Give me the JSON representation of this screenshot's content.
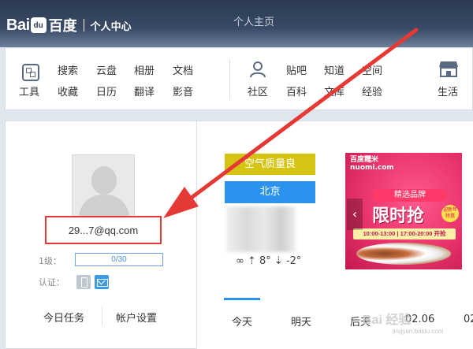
{
  "header": {
    "logo_bai": "Bai",
    "logo_du": "百度",
    "logo_sub": "个人中心",
    "title": "个人主页"
  },
  "toolbar": {
    "tools": "工具",
    "links": [
      [
        "搜索",
        "云盘",
        "相册",
        "文档"
      ],
      [
        "收藏",
        "日历",
        "翻译",
        "影音"
      ]
    ],
    "community": "社区",
    "links2": [
      [
        "贴吧",
        "知道",
        "空间"
      ],
      [
        "百科",
        "文库",
        "经验"
      ]
    ],
    "life": "生活"
  },
  "profile": {
    "email": "29...7@qq.com",
    "level_label": "1级：",
    "level_progress": "0/30",
    "cert_label": "认证：",
    "tasks_btn": "今日任务",
    "settings_btn": "帐户设置"
  },
  "weather": {
    "air_quality": "空气质量良",
    "city": "北京",
    "temp": "⇡ 8° ⇣ -2°",
    "days": [
      "今天",
      "明天",
      "后天",
      "02.06",
      "02"
    ]
  },
  "ad": {
    "logo": "百度糯米",
    "logo_url": "nuomi.com",
    "brand": "精选品牌",
    "main": "限时抢",
    "badge": "迎新年 特惠",
    "time": "10:00-13:00 | 17:00-20:00 开抢"
  },
  "watermark": {
    "text": "Bai 经验",
    "sub": "jingyan.baidu.com"
  },
  "colors": {
    "header_bg": "#2c3a52",
    "air_quality": "#d6c413",
    "city": "#2b93ee",
    "highlight": "#e53935"
  }
}
